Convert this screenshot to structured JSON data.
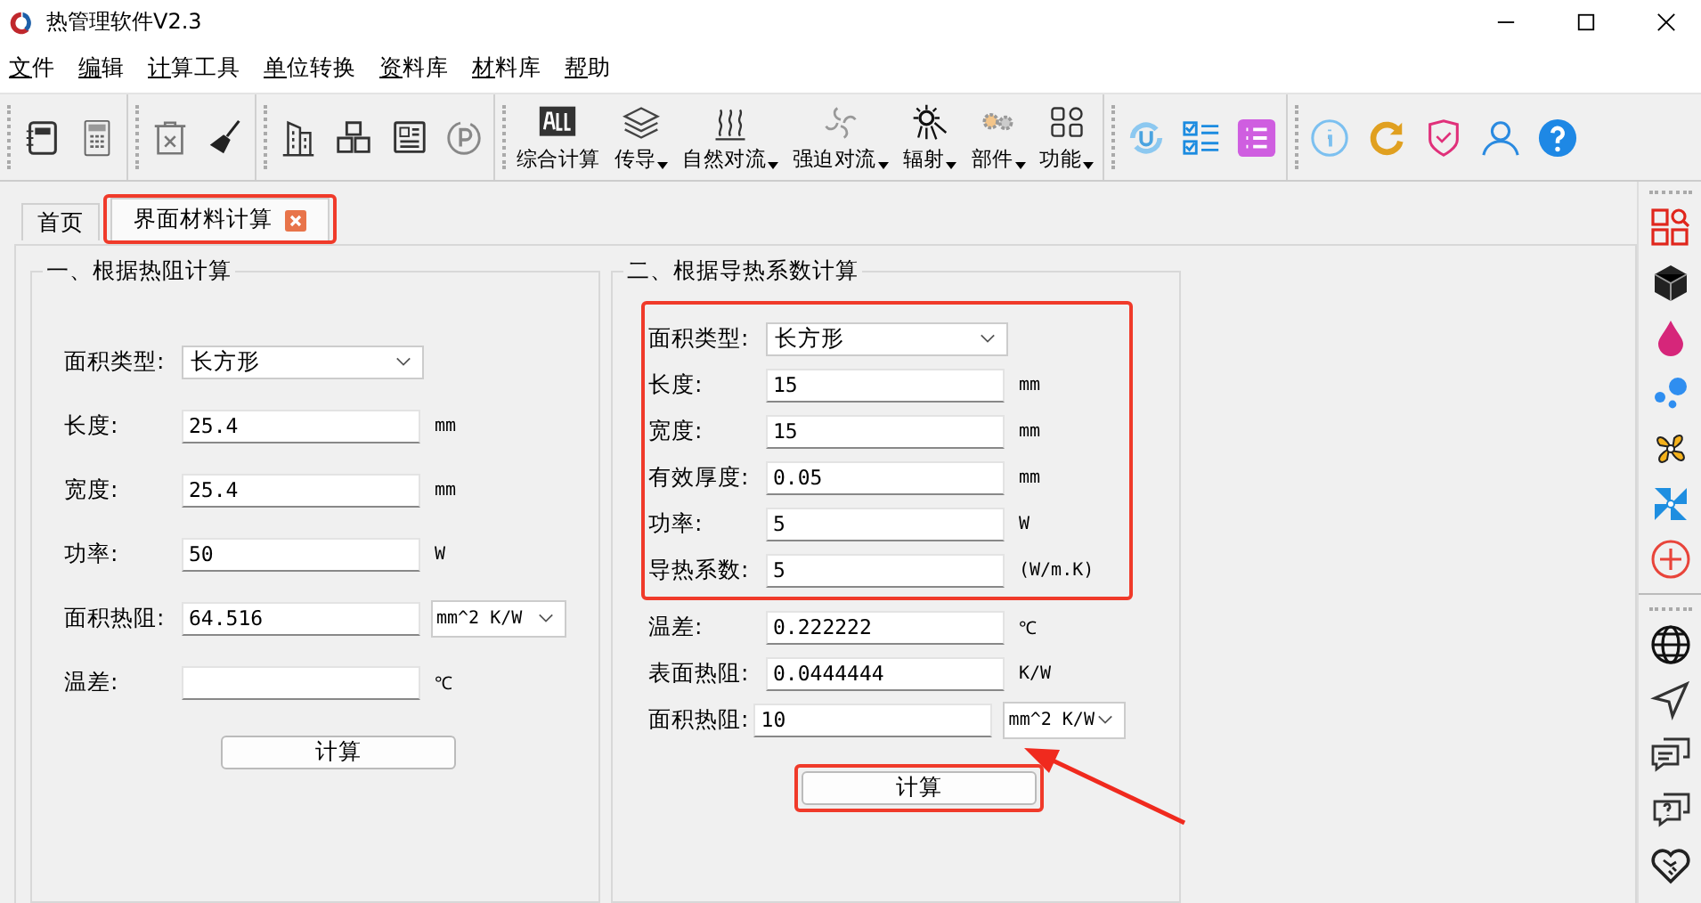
{
  "window": {
    "title": "热管理软件V2.3"
  },
  "menu": [
    "文件",
    "编辑",
    "计算工具",
    "单位转换",
    "资料库",
    "材料库",
    "帮助"
  ],
  "toolbar_buttons": [
    {
      "label": "综合计算",
      "dropdown": false
    },
    {
      "label": "传导",
      "dropdown": true
    },
    {
      "label": "自然对流",
      "dropdown": true
    },
    {
      "label": "强迫对流",
      "dropdown": true
    },
    {
      "label": "辐射",
      "dropdown": true
    },
    {
      "label": "部件",
      "dropdown": true
    },
    {
      "label": "功能",
      "dropdown": true
    }
  ],
  "tabs": [
    {
      "label": "首页",
      "selected": false,
      "closable": false,
      "highlighted": false
    },
    {
      "label": "界面材料计算",
      "selected": true,
      "closable": true,
      "highlighted": true
    }
  ],
  "left_panel": {
    "title": "一、根据热阻计算",
    "rows": [
      {
        "kind": "select",
        "label": "面积类型:",
        "value": "长方形"
      },
      {
        "kind": "input",
        "label": "长度:",
        "value": "25.4",
        "unit": "mm"
      },
      {
        "kind": "input",
        "label": "宽度:",
        "value": "25.4",
        "unit": "mm"
      },
      {
        "kind": "input",
        "label": "功率:",
        "value": "50",
        "unit": "W"
      },
      {
        "kind": "input",
        "label": "面积热阻:",
        "value": "64.516",
        "unit_select": "mm^2 K/W"
      },
      {
        "kind": "input",
        "label": "温差:",
        "value": "",
        "unit": "℃"
      }
    ],
    "button": {
      "label": "计算",
      "highlighted": false
    }
  },
  "right_panel": {
    "title": "二、根据导热系数计算",
    "groups": [
      {
        "highlighted": true,
        "rows": [
          {
            "kind": "select",
            "label": "面积类型:",
            "value": "长方形"
          },
          {
            "kind": "input",
            "label": "长度:",
            "value": "15",
            "unit": "mm"
          },
          {
            "kind": "input",
            "label": "宽度:",
            "value": "15",
            "unit": "mm"
          },
          {
            "kind": "input",
            "label": "有效厚度:",
            "value": "0.05",
            "unit": "mm"
          },
          {
            "kind": "input",
            "label": "功率:",
            "value": "5",
            "unit": "W"
          },
          {
            "kind": "input",
            "label": "导热系数:",
            "value": "5",
            "unit": "(W/m.K)"
          }
        ]
      },
      {
        "highlighted": false,
        "rows": [
          {
            "kind": "input",
            "label": "温差:",
            "value": "0.222222",
            "unit": "℃"
          },
          {
            "kind": "input",
            "label": "表面热阻:",
            "value": "0.0444444",
            "unit": "K/W"
          },
          {
            "kind": "input",
            "label": "面积热阻:",
            "value": "10",
            "unit_select": "mm^2 K/W"
          }
        ]
      }
    ],
    "button": {
      "label": "计算",
      "highlighted": true
    }
  },
  "annotation_arrow": true
}
